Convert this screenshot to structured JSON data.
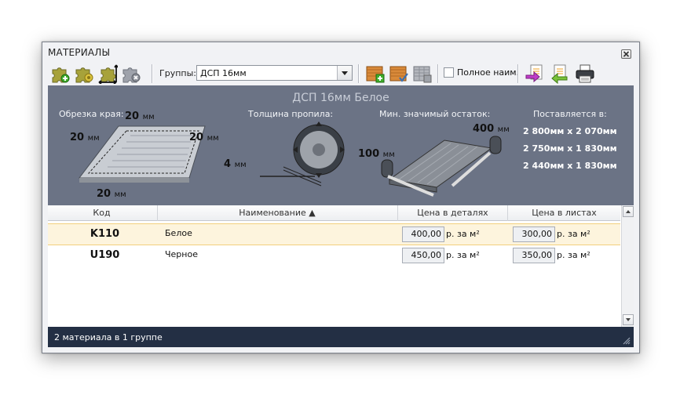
{
  "window": {
    "title": "МАТЕРИАЛЫ"
  },
  "toolbar": {
    "icons": [
      "add-puzzle-icon",
      "edit-puzzle-icon",
      "resize-puzzle-icon",
      "delete-puzzle-icon",
      "add-sheet-icon",
      "check-sheet-icon",
      "grid-sheet-icon",
      "export-icon",
      "import-icon",
      "print-icon"
    ],
    "groups_label": "Группы:",
    "groups_value": "ДСП 16мм",
    "fullname_label": "Полное наим.",
    "fullname_checked": false
  },
  "info": {
    "material_title": "ДСП 16мм Белое",
    "edge_trim_label": "Обрезка края:",
    "edge_top": "20",
    "edge_left": "20",
    "edge_right": "20",
    "edge_bottom": "20",
    "unit_mm": "мм",
    "kerf_label": "Толщина пропила:",
    "kerf_value": "4",
    "min_remnant_label": "Мин. значимый остаток:",
    "remnant_length": "400",
    "remnant_width": "100",
    "supplied_label": "Поставляется в:",
    "sizes": [
      "2 800мм х 2 070мм",
      "2 750мм х 1 830мм",
      "2 440мм х 1 830мм"
    ]
  },
  "table": {
    "headers": {
      "code": "Код",
      "name": "Наименование ▲",
      "price_parts": "Цена в деталях",
      "price_sheets": "Цена в листах"
    },
    "unit": "р. за м²",
    "rows": [
      {
        "code": "K110",
        "name": "Белое",
        "price_parts": "400,00",
        "price_sheets": "300,00",
        "selected": true
      },
      {
        "code": "U190",
        "name": "Черное",
        "price_parts": "450,00",
        "price_sheets": "350,00",
        "selected": false
      }
    ]
  },
  "status": {
    "text": "2 материала в 1 группе"
  },
  "colors": {
    "info_bg": "#6b7385",
    "status_bg": "#232f44",
    "selected_row": "#fdf4dd"
  }
}
